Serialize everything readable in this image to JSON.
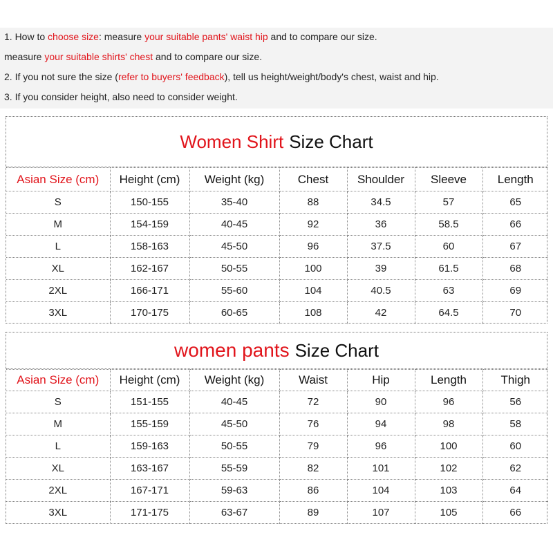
{
  "notes": {
    "line1": {
      "a": "1. How to ",
      "b": "choose size",
      "c": ": measure ",
      "d": "your suitable pants' waist hip",
      "e": " and to compare our size."
    },
    "line2": {
      "a": "measure ",
      "b": "your suitable shirts' chest",
      "c": " and to compare our size."
    },
    "line3": {
      "a": "2. If you not sure the size (",
      "b": "refer to buyers' feedback",
      "c": "), tell us height/weight/body's chest, waist and hip."
    },
    "line4": "3. If you consider height, also need to consider weight."
  },
  "shirt": {
    "title_red": "Women Shirt",
    "title_black": "Size Chart",
    "headers": [
      "Asian Size (cm)",
      "Height (cm)",
      "Weight (kg)",
      "Chest",
      "Shoulder",
      "Sleeve",
      "Length"
    ],
    "rows": [
      [
        "S",
        "150-155",
        "35-40",
        "88",
        "34.5",
        "57",
        "65"
      ],
      [
        "M",
        "154-159",
        "40-45",
        "92",
        "36",
        "58.5",
        "66"
      ],
      [
        "L",
        "158-163",
        "45-50",
        "96",
        "37.5",
        "60",
        "67"
      ],
      [
        "XL",
        "162-167",
        "50-55",
        "100",
        "39",
        "61.5",
        "68"
      ],
      [
        "2XL",
        "166-171",
        "55-60",
        "104",
        "40.5",
        "63",
        "69"
      ],
      [
        "3XL",
        "170-175",
        "60-65",
        "108",
        "42",
        "64.5",
        "70"
      ]
    ]
  },
  "pants": {
    "title_red": "women pants",
    "title_black": "Size Chart",
    "headers": [
      "Asian Size (cm)",
      "Height (cm)",
      "Weight (kg)",
      "Waist",
      "Hip",
      "Length",
      "Thigh"
    ],
    "rows": [
      [
        "S",
        "151-155",
        "40-45",
        "72",
        "90",
        "96",
        "56"
      ],
      [
        "M",
        "155-159",
        "45-50",
        "76",
        "94",
        "98",
        "58"
      ],
      [
        "L",
        "159-163",
        "50-55",
        "79",
        "96",
        "100",
        "60"
      ],
      [
        "XL",
        "163-167",
        "55-59",
        "82",
        "101",
        "102",
        "62"
      ],
      [
        "2XL",
        "167-171",
        "59-63",
        "86",
        "104",
        "103",
        "64"
      ],
      [
        "3XL",
        "171-175",
        "63-67",
        "89",
        "107",
        "105",
        "66"
      ]
    ]
  }
}
